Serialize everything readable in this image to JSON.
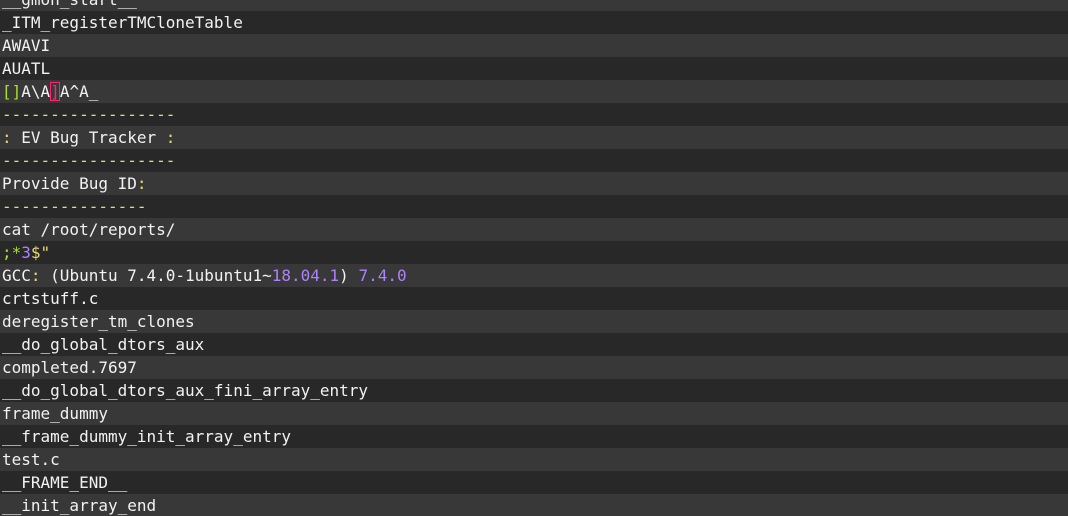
{
  "lines": [
    [
      {
        "t": "__gmon_start__",
        "c": "white"
      }
    ],
    [
      {
        "t": "_ITM_registerTMCloneTable",
        "c": "white"
      }
    ],
    [
      {
        "t": "AWAVI",
        "c": "white"
      }
    ],
    [
      {
        "t": "AUATL",
        "c": "white"
      }
    ],
    [
      {
        "t": "[]",
        "c": "green"
      },
      {
        "t": "A\\A",
        "c": "white"
      },
      {
        "t": "]",
        "c": "red"
      },
      {
        "t": "A^A_",
        "c": "white"
      }
    ],
    [
      {
        "t": "------------------",
        "c": "yellow"
      }
    ],
    [
      {
        "t": ": ",
        "c": "yellow"
      },
      {
        "t": "EV Bug Tracker",
        "c": "white"
      },
      {
        "t": " :",
        "c": "yellow"
      }
    ],
    [
      {
        "t": "------------------",
        "c": "yellow"
      }
    ],
    [
      {
        "t": "Provide Bug ID",
        "c": "white"
      },
      {
        "t": ":",
        "c": "yellow"
      }
    ],
    [
      {
        "t": "---------------",
        "c": "yellow"
      }
    ],
    [
      {
        "t": "cat /root/reports/",
        "c": "white"
      }
    ],
    [
      {
        "t": ";*",
        "c": "lime"
      },
      {
        "t": "3",
        "c": "purple"
      },
      {
        "t": "$\"",
        "c": "yellow"
      }
    ],
    [
      {
        "t": "GCC",
        "c": "white"
      },
      {
        "t": ": ",
        "c": "yellow"
      },
      {
        "t": "(Ubuntu 7.4.0-1ubuntu1~",
        "c": "white"
      },
      {
        "t": "18.04.1",
        "c": "purple"
      },
      {
        "t": ") ",
        "c": "white"
      },
      {
        "t": "7.4.0",
        "c": "purple"
      }
    ],
    [
      {
        "t": "crtstuff.c",
        "c": "white"
      }
    ],
    [
      {
        "t": "deregister_tm_clones",
        "c": "white"
      }
    ],
    [
      {
        "t": "__do_global_dtors_aux",
        "c": "white"
      }
    ],
    [
      {
        "t": "completed.7697",
        "c": "white"
      }
    ],
    [
      {
        "t": "__do_global_dtors_aux_fini_array_entry",
        "c": "white"
      }
    ],
    [
      {
        "t": "frame_dummy",
        "c": "white"
      }
    ],
    [
      {
        "t": "__frame_dummy_init_array_entry",
        "c": "white"
      }
    ],
    [
      {
        "t": "test.c",
        "c": "white"
      }
    ],
    [
      {
        "t": "__FRAME_END__",
        "c": "white"
      }
    ],
    [
      {
        "t": "__init_array_end",
        "c": "white"
      }
    ]
  ],
  "colors": {
    "background": "#282828",
    "stripe": "#383838",
    "text": "#f2f2f2",
    "yellow": "#e6db74",
    "purple": "#ae81ff",
    "green": "#a6e22e",
    "red": "#f92672"
  }
}
